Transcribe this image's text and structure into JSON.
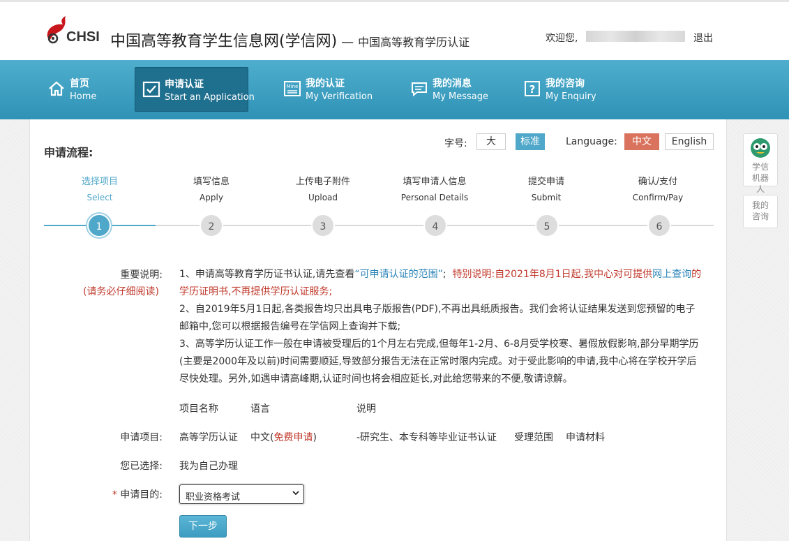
{
  "header": {
    "logo_text": "CHSI",
    "site_title": "中国高等教育学生信息网(学信网)",
    "site_dash": "—",
    "site_sub": "中国高等教育学历认证",
    "welcome": "欢迎您,",
    "logout": "退出"
  },
  "nav": [
    {
      "zh": "首页",
      "en": "Home",
      "icon": "home-icon"
    },
    {
      "zh": "申请认证",
      "en": "Start an Application",
      "icon": "checkbox-icon"
    },
    {
      "zh": "我的认证",
      "en": "My Verification",
      "icon": "mine-icon"
    },
    {
      "zh": "我的消息",
      "en": "My Message",
      "icon": "message-icon"
    },
    {
      "zh": "我的咨询",
      "en": "My Enquiry",
      "icon": "question-icon"
    }
  ],
  "toolbar": {
    "flow_title": "申请流程:",
    "font_label": "字号:",
    "font_large": "大",
    "font_standard": "标准",
    "language_label": "Language:",
    "lang_zh": "中文",
    "lang_en": "English"
  },
  "steps": [
    {
      "zh": "选择项目",
      "en": "Select",
      "num": "1"
    },
    {
      "zh": "填写信息",
      "en": "Apply",
      "num": "2"
    },
    {
      "zh": "上传电子附件",
      "en": "Upload",
      "num": "3"
    },
    {
      "zh": "填写申请人信息",
      "en": "Personal Details",
      "num": "4"
    },
    {
      "zh": "提交申请",
      "en": "Submit",
      "num": "5"
    },
    {
      "zh": "确认/支付",
      "en": "Confirm/Pay",
      "num": "6"
    }
  ],
  "notes": {
    "label": "重要说明:",
    "sublabel": "(请务必仔细阅读)",
    "n1_a": "1、申请高等教育学历证书认证,请先查看",
    "n1_link": "“可申请认证的范围”",
    "n1_b": ";",
    "n1_red1": "特别说明:自2021年8月1日起,我中心对可提供",
    "n1_link2": "网上查询",
    "n1_red2": "的学历证明书,不再提供学历认证服务;",
    "n2": "2、自2019年5月1日起,各类报告均只出具电子版报告(PDF),不再出具纸质报告。我们会将认证结果发送到您预留的电子邮箱中,您可以根据报告编号在学信网上查询并下载;",
    "n3": "3、高等学历认证工作一般在申请被受理后的1个月左右完成,但每年1-2月、6-8月受学校寒、暑假放假影响,部分早期学历(主要是2000年及以前)时间需要顺延,导致部分报告无法在正常时限内完成。对于受此影响的申请,我中心将在学校开学后尽快处理。另外,如遇申请高峰期,认证时间也将会相应延长,对此给您带来的不便,敬请谅解。"
  },
  "table": {
    "col_name": "项目名称",
    "col_lang": "语言",
    "col_desc": "说明",
    "row_label": "申请项目:",
    "item_name": "高等学历认证",
    "item_lang": "中文(",
    "item_lang_free": "免费申请",
    "item_lang_close": ")",
    "item_desc": "-研究生、本专科等毕业证书认证",
    "link_scope": "受理范围",
    "link_materials": "申请材料"
  },
  "selection": {
    "label": "您已选择:",
    "value": "我为自己办理"
  },
  "purpose": {
    "required_mark": "*",
    "label": "申请目的:",
    "selected": "职业资格考试"
  },
  "next_button": "下一步",
  "side": {
    "robot": "学信机器人",
    "enquiry": "我的咨询"
  }
}
